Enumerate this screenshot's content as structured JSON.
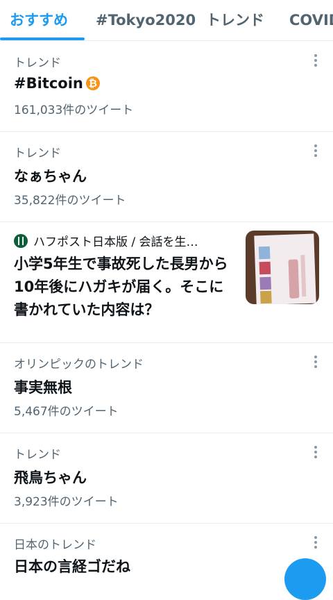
{
  "tabs": [
    {
      "label": "おすすめ",
      "active": true
    },
    {
      "label": "#Tokyo2020"
    },
    {
      "label": "トレンド"
    },
    {
      "label": "COVID"
    }
  ],
  "items": [
    {
      "type": "trend",
      "category": "トレンド",
      "title": "#Bitcoin",
      "tweet_count": "161,033件のツイート",
      "icon": "bitcoin-icon"
    },
    {
      "type": "trend",
      "category": "トレンド",
      "title": "なぁちゃん",
      "tweet_count": "35,822件のツイート"
    },
    {
      "type": "news",
      "source": "ハフポスト日本版 / 会話を生…",
      "headline": "小学5年生で事故死した長男から10年後にハガキが届く。そこに書かれていた内容は？"
    },
    {
      "type": "trend",
      "category": "オリンピックのトレンド",
      "title": "事実無根",
      "tweet_count": "5,467件のツイート"
    },
    {
      "type": "trend",
      "category": "トレンド",
      "title": "飛鳥ちゃん",
      "tweet_count": "3,923件のツイート"
    },
    {
      "type": "trend",
      "category": "日本のトレンド",
      "title": "日本の言経ゴだね"
    }
  ],
  "colors": {
    "accent": "#1d9bf0",
    "muted": "#536471",
    "bitcoin": "#f7931a"
  }
}
